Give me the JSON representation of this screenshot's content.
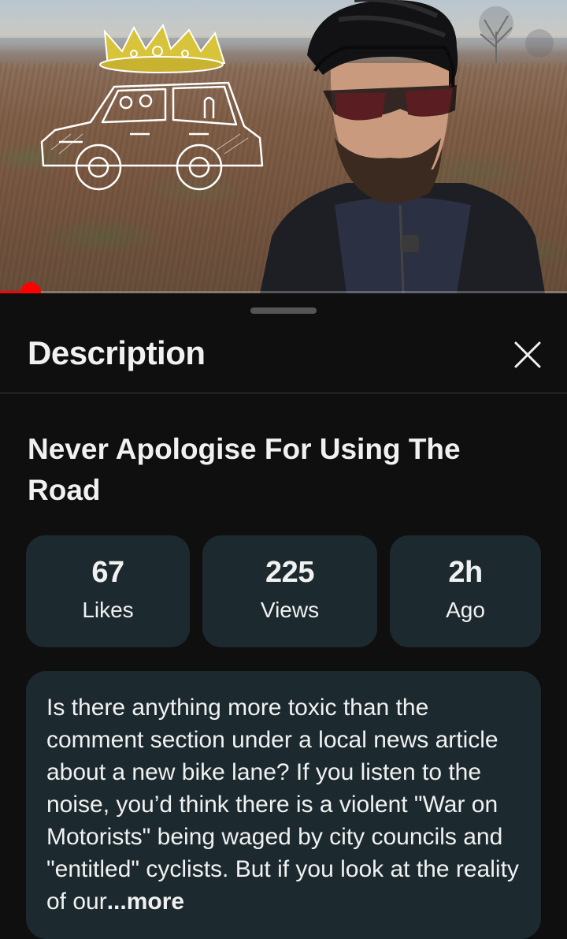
{
  "video": {
    "progress_fraction": 0.054
  },
  "panel": {
    "title": "Description"
  },
  "video_title": "Never Apologise For Using The Road",
  "stats": [
    {
      "value": "67",
      "label": "Likes"
    },
    {
      "value": "225",
      "label": "Views"
    },
    {
      "value": "2h",
      "label": "Ago"
    }
  ],
  "description": {
    "text": "Is there anything more toxic than the comment section under a local news article about a new bike lane? If you listen to the noise, you’d think there is a violent \"War on Motorists\" being waged by city councils and \"entitled\" cyclists. But if you look at the reality of our",
    "more_label": "...more"
  },
  "colors": {
    "accent": "#ff0000",
    "card_bg": "#1c2a2f",
    "background": "#0f0f0f"
  }
}
